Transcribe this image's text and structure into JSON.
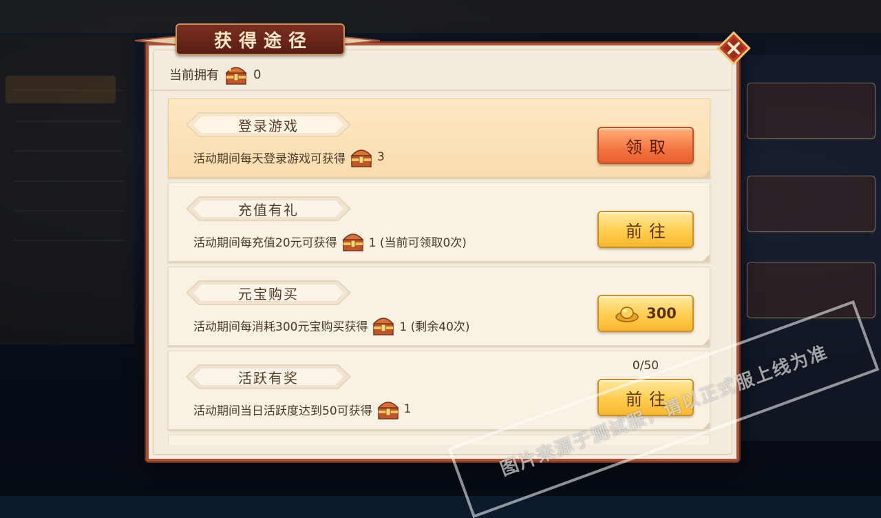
{
  "dialog": {
    "title": "获得途径",
    "owned_label": "当前拥有",
    "owned_count": "0"
  },
  "tasks": [
    {
      "name": "登录游戏",
      "desc_pre": "活动期间每天登录游戏可获得",
      "desc_post": "3",
      "button": "领取",
      "button_style": "red"
    },
    {
      "name": "充值有礼",
      "desc_pre": "活动期间每充值20元可获得",
      "desc_post": "1 (当前可领取0次)",
      "button": "前往",
      "button_style": "yellow"
    },
    {
      "name": "元宝购买",
      "desc_pre": "活动期间每消耗300元宝购买获得",
      "desc_post": "1 (剩余40次)",
      "button": "300",
      "button_icon": "gold-ingot-icon",
      "button_style": "yellow"
    },
    {
      "name": "活跃有奖",
      "desc_pre": "活动期间当日活跃度达到50可获得",
      "desc_post": "1",
      "progress": "0/50",
      "button": "前往",
      "button_style": "yellow"
    }
  ],
  "watermark": "图片来源于测试服，请以正式服上线为准",
  "colors": {
    "frame": "#a4523a",
    "panel": "#f3ebdd",
    "button_red": "#f47a45",
    "button_yellow": "#ffcd4f",
    "text": "#4a3828"
  },
  "icons": [
    "close-icon",
    "treasure-chest-icon",
    "gold-ingot-icon"
  ]
}
